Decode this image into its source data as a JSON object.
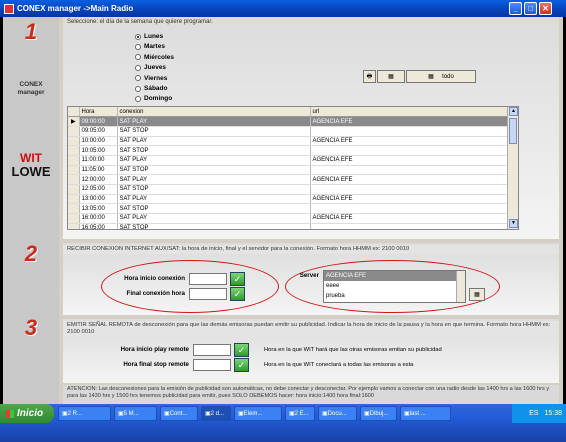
{
  "window": {
    "title": "CONEX manager   ->Main Radio"
  },
  "sidebar": {
    "step1": "1",
    "step2": "2",
    "step3": "3",
    "logo_line1": "CONEX",
    "logo_line2": "manager",
    "wit": "WIT",
    "lowe": "LOWE"
  },
  "section1": {
    "instruction": "Seleccione: el día de la semana que quiere programar.",
    "days": [
      "Lunes",
      "Martes",
      "Miércoles",
      "Jueves",
      "Viernes",
      "Sábado",
      "Domingo"
    ],
    "selected_day": "Lunes",
    "todo_label": "todo",
    "grid": {
      "columns": [
        "Hora",
        "conexion",
        "url"
      ],
      "rows": [
        {
          "hora": "09:00:00",
          "conexion": "SAT PLAY",
          "url": "AGENCIA EFE"
        },
        {
          "hora": "09:05:00",
          "conexion": "SAT STOP",
          "url": ""
        },
        {
          "hora": "10:00:00",
          "conexion": "SAT PLAY",
          "url": "AGENCIA EFE"
        },
        {
          "hora": "10:05:00",
          "conexion": "SAT STOP",
          "url": ""
        },
        {
          "hora": "11:00:00",
          "conexion": "SAT PLAY",
          "url": "AGENCIA EFE"
        },
        {
          "hora": "11:05:00",
          "conexion": "SAT STOP",
          "url": ""
        },
        {
          "hora": "12:00:00",
          "conexion": "SAT PLAY",
          "url": "AGENCIA EFE"
        },
        {
          "hora": "12:05:00",
          "conexion": "SAT STOP",
          "url": ""
        },
        {
          "hora": "13:00:00",
          "conexion": "SAT PLAY",
          "url": "AGENCIA EFE"
        },
        {
          "hora": "13:05:00",
          "conexion": "SAT STOP",
          "url": ""
        },
        {
          "hora": "16:00:00",
          "conexion": "SAT PLAY",
          "url": "AGENCIA EFE"
        },
        {
          "hora": "16:05:00",
          "conexion": "SAT STOP",
          "url": ""
        }
      ]
    }
  },
  "section2": {
    "header": "RECIBIR CONEXION INTERNET AUX/SAT: la hora de inicio, final  y el servidor para la conexión.   Formato hora   HHMM   ex:  2100    0010",
    "inicio_label": "Hora inicio conexión",
    "final_label": "Final conexión hora",
    "server_label": "Server",
    "servers": [
      "AGENCIA EFE",
      "eeee",
      "prueba"
    ],
    "selected_server": "AGENCIA EFE"
  },
  "section3": {
    "header": "EMITIR SEÑAL REMOTA de desconexión para que las demás emisoras puedan emitir su publicidad. Indicar la hora de inicio de la pausa y la hora en que termina. Formato hora HHMM ex: 2100    0010",
    "play_label": "Hora inicio play remote",
    "stop_label": "Hora final stop remote",
    "play_desc": "Hora en la que WIT hará que las otras emisoras emitan su publicidad",
    "stop_desc": "Hora en la que WIT  conectará a todas las emisoras a esta"
  },
  "note": "ATENCION:  Las desconexiones para la emisión de publicidad son automáticas, no debe conectar y desconectar. Por ejemplo vamos a conectar con una radio desde las 1400 hrs a las 1600 hrs y  para las 1430 hrs y  1500 hrs tenemos publicidad para emitir, pues SOLO DEBEMOS hacer:   hora inicio:1400    hora final:1600",
  "taskbar": {
    "start": "Inicio",
    "items": [
      "2 R...",
      "5 M...",
      "Cont...",
      "2 d...",
      "Elem...",
      "2 E...",
      "Docu...",
      "Dibuj...",
      "last ..."
    ],
    "active_index": 3,
    "lang": "ES",
    "clock": "15:38"
  },
  "colors": {
    "title_blue": "#0841b8",
    "accent_red": "#cc2a1a",
    "oval_red": "#d01818",
    "taskbar_blue": "#245edb",
    "start_green": "#2f8a2d"
  }
}
